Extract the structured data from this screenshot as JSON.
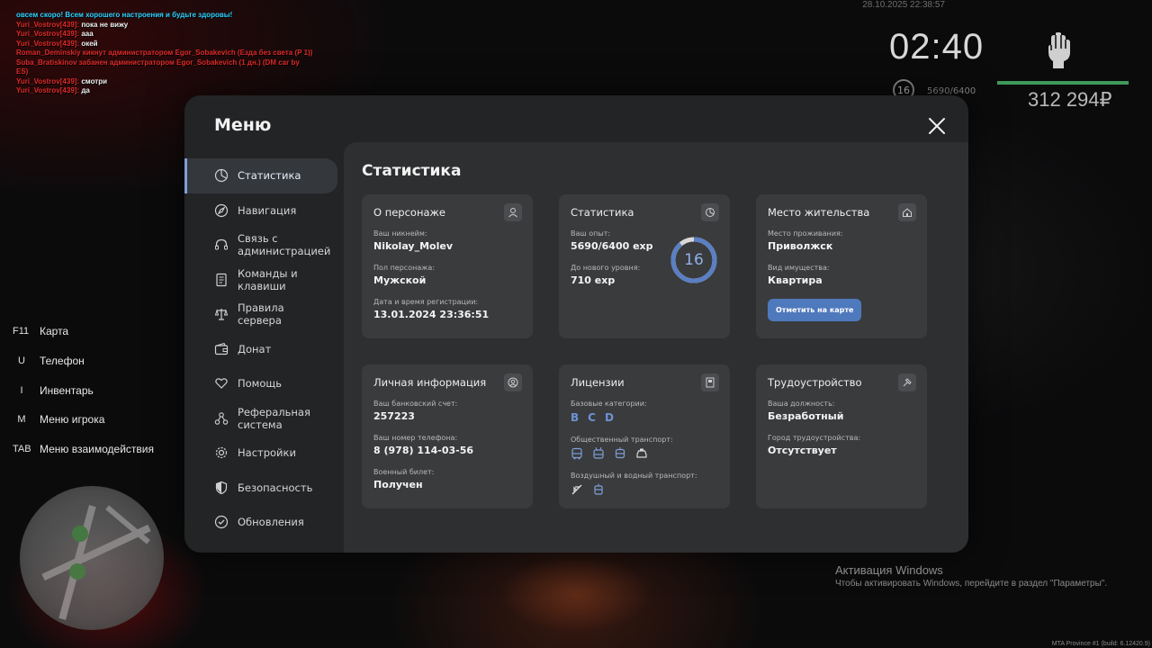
{
  "chat": [
    {
      "parts": [
        {
          "c": "cyan",
          "t": "овсем скоро! Всем хорошего настроения и будьте здоровы!"
        }
      ]
    },
    {
      "parts": [
        {
          "c": "red",
          "t": "Yuri_Vostrov[439]: "
        },
        {
          "c": "white",
          "t": "пока не вижу"
        }
      ]
    },
    {
      "parts": [
        {
          "c": "red",
          "t": "Yuri_Vostrov[439]: "
        },
        {
          "c": "white",
          "t": "ааа"
        }
      ]
    },
    {
      "parts": [
        {
          "c": "red",
          "t": "Yuri_Vostrov[439]: "
        },
        {
          "c": "white",
          "t": "окей"
        }
      ]
    },
    {
      "parts": [
        {
          "c": "red",
          "t": "Roman_Deminskiy кикнут администратором Egor_Sobakevich (Езда без света (Р 1))"
        }
      ]
    },
    {
      "parts": [
        {
          "c": "red",
          "t": "Suba_Bratiskinov забанен администратором Egor_Sobakevich (1 дн.) (DM car by ES)"
        }
      ]
    },
    {
      "parts": [
        {
          "c": "red",
          "t": "Yuri_Vostrov[439]: "
        },
        {
          "c": "white",
          "t": "смотри"
        }
      ]
    },
    {
      "parts": [
        {
          "c": "red",
          "t": "Yuri_Vostrov[439]: "
        },
        {
          "c": "white",
          "t": "да"
        }
      ]
    }
  ],
  "hud": {
    "datetime": "28.10.2025 22:38:57",
    "clock": "02:40",
    "level": "16",
    "exp": "5690/6400",
    "money": "312 294₽",
    "health_fraction": 1.0
  },
  "keys": [
    {
      "key": "F11",
      "label": "Карта"
    },
    {
      "key": "U",
      "label": "Телефон"
    },
    {
      "key": "I",
      "label": "Инвентарь"
    },
    {
      "key": "M",
      "label": "Меню игрока"
    },
    {
      "key": "TAB",
      "label": "Меню взаимодействия"
    }
  ],
  "menu": {
    "title": "Меню",
    "nav": [
      {
        "id": "stats",
        "label": "Статистика",
        "icon": "pie-chart-icon",
        "active": true
      },
      {
        "id": "navigation",
        "label": "Навигация",
        "icon": "compass-icon"
      },
      {
        "id": "admin-contact",
        "label": "Связь с администрацией",
        "icon": "headset-icon"
      },
      {
        "id": "commands",
        "label": "Команды и клавиши",
        "icon": "document-icon"
      },
      {
        "id": "rules",
        "label": "Правила сервера",
        "icon": "scales-icon"
      },
      {
        "id": "donate",
        "label": "Донат",
        "icon": "wallet-icon"
      },
      {
        "id": "help",
        "label": "Помощь",
        "icon": "heart-hands-icon"
      },
      {
        "id": "referral",
        "label": "Реферальная система",
        "icon": "network-icon"
      },
      {
        "id": "settings",
        "label": "Настройки",
        "icon": "gear-icon"
      },
      {
        "id": "security",
        "label": "Безопасность",
        "icon": "shield-icon"
      },
      {
        "id": "updates",
        "label": "Обновления",
        "icon": "check-circle-icon"
      }
    ]
  },
  "stats": {
    "title": "Статистика",
    "character": {
      "title": "О персонаже",
      "nickname_label": "Ваш никнейм:",
      "nickname": "Nikolay_Molev",
      "gender_label": "Пол персонажа:",
      "gender": "Мужской",
      "reg_label": "Дата и время регистрации:",
      "reg": "13.01.2024 23:36:51"
    },
    "statistics": {
      "title": "Статистика",
      "exp_label": "Ваш опыт:",
      "exp": "5690/6400 exp",
      "next_label": "До нового уровня:",
      "next": "710 exp",
      "level": "16",
      "progress": 0.889
    },
    "residence": {
      "title": "Место жительства",
      "place_label": "Место проживания:",
      "place": "Приволжск",
      "property_label": "Вид имущества:",
      "property": "Квартира",
      "map_button": "Отметить на карте"
    },
    "personal": {
      "title": "Личная информация",
      "bank_label": "Ваш банковский счет:",
      "bank": "257223",
      "phone_label": "Ваш номер телефона:",
      "phone": "8 (978) 114-03-56",
      "military_label": "Военный билет:",
      "military": "Получен"
    },
    "licenses": {
      "title": "Лицензии",
      "basic_label": "Базовые категории:",
      "basic": [
        "B",
        "C",
        "D"
      ],
      "public_label": "Общественный транспорт:",
      "air_label": "Воздушный и водный транспорт:"
    },
    "employment": {
      "title": "Трудоустройство",
      "position_label": "Ваша должность:",
      "position": "Безработный",
      "city_label": "Город трудоустройства:",
      "city": "Отсутствует"
    }
  },
  "system": {
    "activation_title": "Активация Windows",
    "activation_text": "Чтобы активировать Windows, перейдите в раздел \"Параметры\".",
    "build": "MTA Province #1 (build: 6.12420.9)"
  },
  "colors": {
    "accent": "#4f79bd",
    "ring": "#5a7fc2",
    "chat_red": "#e02a2a",
    "chat_cyan": "#2fd3ff"
  }
}
